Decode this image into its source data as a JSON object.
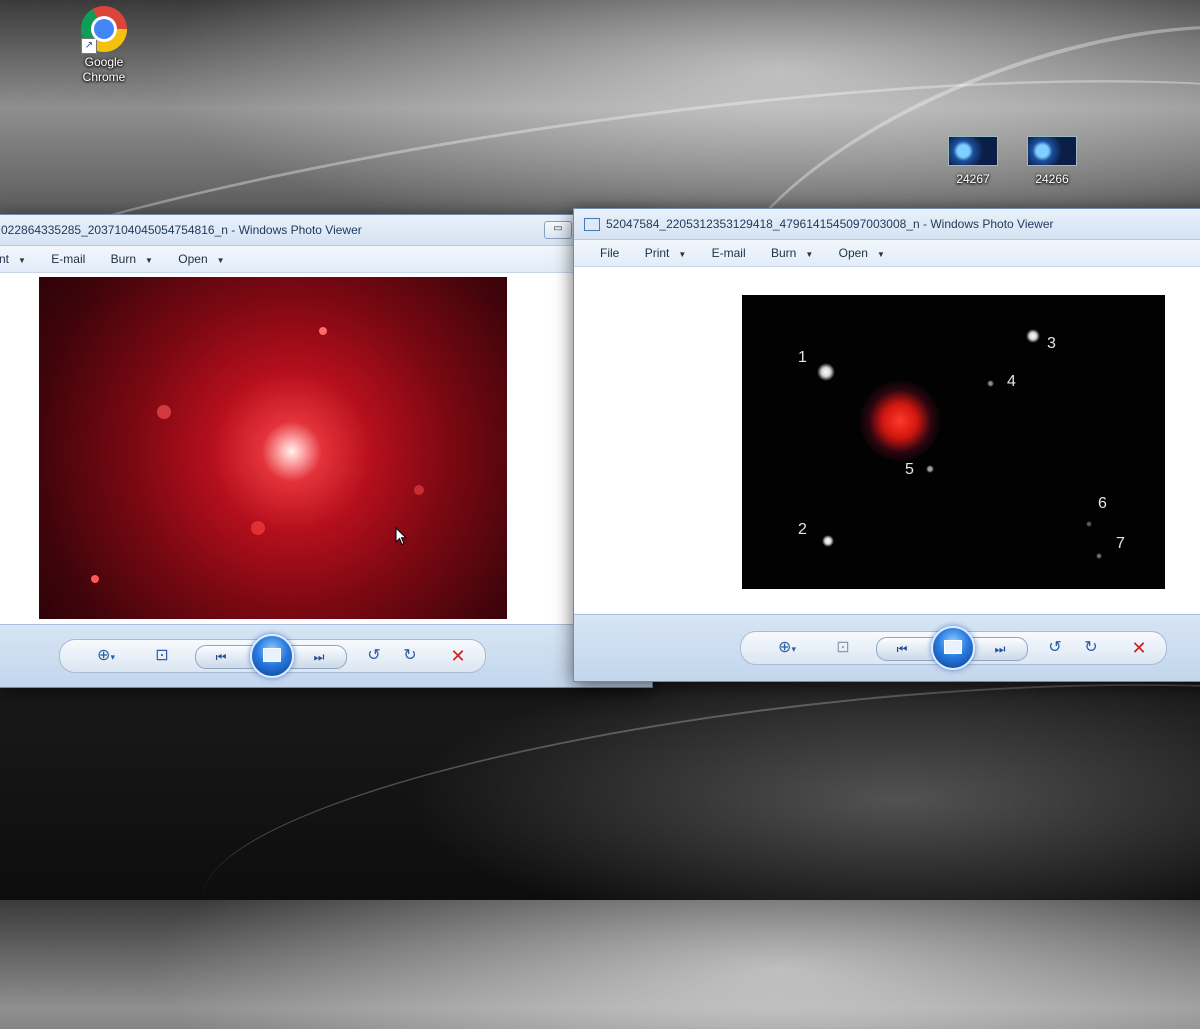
{
  "desktop": {
    "icons": [
      {
        "label_line1": "Google",
        "label_line2": "Chrome",
        "icon": "chrome-icon"
      },
      {
        "label": "24267",
        "icon": "image-thumbnail-icon"
      },
      {
        "label": "24266",
        "icon": "image-thumbnail-icon"
      }
    ]
  },
  "left_window": {
    "title": "022864335285_2037104045054754816_n - Windows Photo Viewer",
    "menu": [
      "nt",
      "E-mail",
      "Burn",
      "Open"
    ]
  },
  "right_window": {
    "title": "52047584_2205312353129418_4796141545097003008_n - Windows Photo Viewer",
    "menu": [
      "File",
      "Print",
      "E-mail",
      "Burn",
      "Open"
    ],
    "star_labels": [
      "1",
      "2",
      "3",
      "4",
      "5",
      "6",
      "7"
    ]
  },
  "toolbar_icons": [
    "zoom-icon",
    "actual-size-icon",
    "previous-icon",
    "slideshow-icon",
    "next-icon",
    "rotate-counterclockwise-icon",
    "rotate-clockwise-icon",
    "delete-icon"
  ],
  "colors": {
    "delete": "#d01e1e",
    "accent": "#2a7be0",
    "window_frame": "#6e8bb0"
  }
}
